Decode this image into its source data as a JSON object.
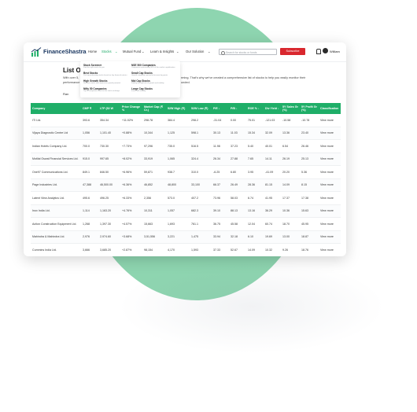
{
  "brand": {
    "name": "FinanceShastra",
    "accent": "#1fae68",
    "subscribe_color": "#d9272e"
  },
  "nav": {
    "items": [
      "Home",
      "Stocks",
      "Mutual Fund",
      "Learn & Insights",
      "Our Solution"
    ],
    "active": "Stocks",
    "search_placeholder": "Search for stocks or funds",
    "subscribe": "Subscribe",
    "user": "William"
  },
  "dropdown": {
    "items": [
      {
        "title": "Stock Screener",
        "desc": "Find the right stocks for you"
      },
      {
        "title": "NSE 500 Companies",
        "desc": "Companies representing 96% of the market capitalization"
      },
      {
        "title": "Best Stocks",
        "desc": "Pick top performing stocks based on key financial metrics"
      },
      {
        "title": "Small Cap Stocks",
        "desc": "Growth companies poised to become big giants"
      },
      {
        "title": "High Growth Stocks",
        "desc": "Discover stocks with impressive growth potential"
      },
      {
        "title": "Mid Cap Stocks",
        "desc": "Finding the right mix of growth and stability"
      },
      {
        "title": "Nifty 50 Companies",
        "desc": "Top 50 companies listed on the stock exchange"
      },
      {
        "title": "Large Cap Stocks",
        "desc": "Invest with stability"
      }
    ]
  },
  "page": {
    "title": "List Of",
    "desc_left": "With over 5,",
    "desc_left2": "performance",
    "desc_right": "rming. That's why we've created a comprehensive list of stocks to help you easily monitor their",
    "desc_right2": "unded.",
    "count_label": "Ran"
  },
  "table": {
    "headers": [
      "Company",
      "CMP ₹",
      "LTP (52 W",
      "Price Change %",
      "Market Cap (₹ Cr.)",
      "52W High (₹)",
      "52W Low (₹)",
      "P/E ↓",
      "P/B ↓",
      "ROE % ↓",
      "Div Yield ↓",
      "5Y Sales Gr (%)",
      "5Y Profit Gr (%)",
      "Classification"
    ],
    "rows": [
      [
        "ITI Ltd.",
        "393.6",
        "354.34",
        "+11.02%",
        "298.78",
        "384.4",
        "298.2",
        "-31.04",
        "0.00",
        "75.01",
        "-121.03",
        "-10.58",
        "-10.78",
        "View more"
      ],
      [
        "Vijaya Diagnostic Centre Ltd",
        "1,056",
        "1,101.40",
        "+0.88%",
        "10,344",
        "1,125",
        "598.1",
        "30.13",
        "11.03",
        "15.34",
        "32.09",
        "13.36",
        "23.40",
        "View more"
      ],
      [
        "Indian Hotels Company Ltd.",
        "700.0",
        "730.30",
        "+7.73%",
        "97,296",
        "735.0",
        "516.5",
        "11.98",
        "37.23",
        "5.40",
        "40.01",
        "6.54",
        "26.46",
        "View more"
      ],
      [
        "Motilal Oswal Financial Services Ltd.",
        "915.0",
        "997.65",
        "+8.02%",
        "33,919",
        "1,065",
        "324.4",
        "26.34",
        "27.88",
        "7.65",
        "14.11",
        "26.19",
        "25.13",
        "View more"
      ],
      [
        "One97 Communications Ltd.",
        "849.1",
        "846.50",
        "+6.96%",
        "59,871",
        "938.7",
        "310.0",
        "-6.25",
        "6.80",
        "3.95",
        "-41.09",
        "20.20",
        "5.36",
        "View more"
      ],
      [
        "Page Industries Ltd.",
        "47,388",
        "46,500.00",
        "+6.36%",
        "46,852",
        "48,800",
        "33,100",
        "66.37",
        "26.49",
        "28.36",
        "81.15",
        "14.09",
        "8.15",
        "View more"
      ],
      [
        "Latent View Analytics Ltd.",
        "495.6",
        "496.25",
        "+6.33%",
        "2,356",
        "573.0",
        "407.2",
        "73.96",
        "58.03",
        "6.74",
        "41.95",
        "17.37",
        "17.38",
        "View more"
      ],
      [
        "Inox India Ltd.",
        "1,114",
        "1,163.20",
        "+4.76%",
        "10,311",
        "1,057",
        "682.3",
        "39.10",
        "88.13",
        "13.16",
        "36.29",
        "10.36",
        "15.63",
        "View more"
      ],
      [
        "Action Construction Equipment Ltd.",
        "1,268",
        "1,397.30",
        "+4.57%",
        "15,663",
        "1,693",
        "761.1",
        "36.75",
        "45.58",
        "12.04",
        "60.74",
        "18.70",
        "45.95",
        "View more"
      ],
      [
        "Mahindra & Mahindra Ltd.",
        "2,976",
        "2,974.60",
        "+3.68%",
        "3,51,556",
        "3,221",
        "1,475",
        "33.94",
        "32.18",
        "6.10",
        "19.69",
        "13.00",
        "18.87",
        "View more"
      ],
      [
        "Cummins India Ltd.",
        "3,666",
        "3,685.20",
        "+2.87%",
        "98,154",
        "4,170",
        "1,593",
        "37.33",
        "52.67",
        "14.09",
        "10.32",
        "9.26",
        "18.76",
        "View more"
      ]
    ]
  }
}
